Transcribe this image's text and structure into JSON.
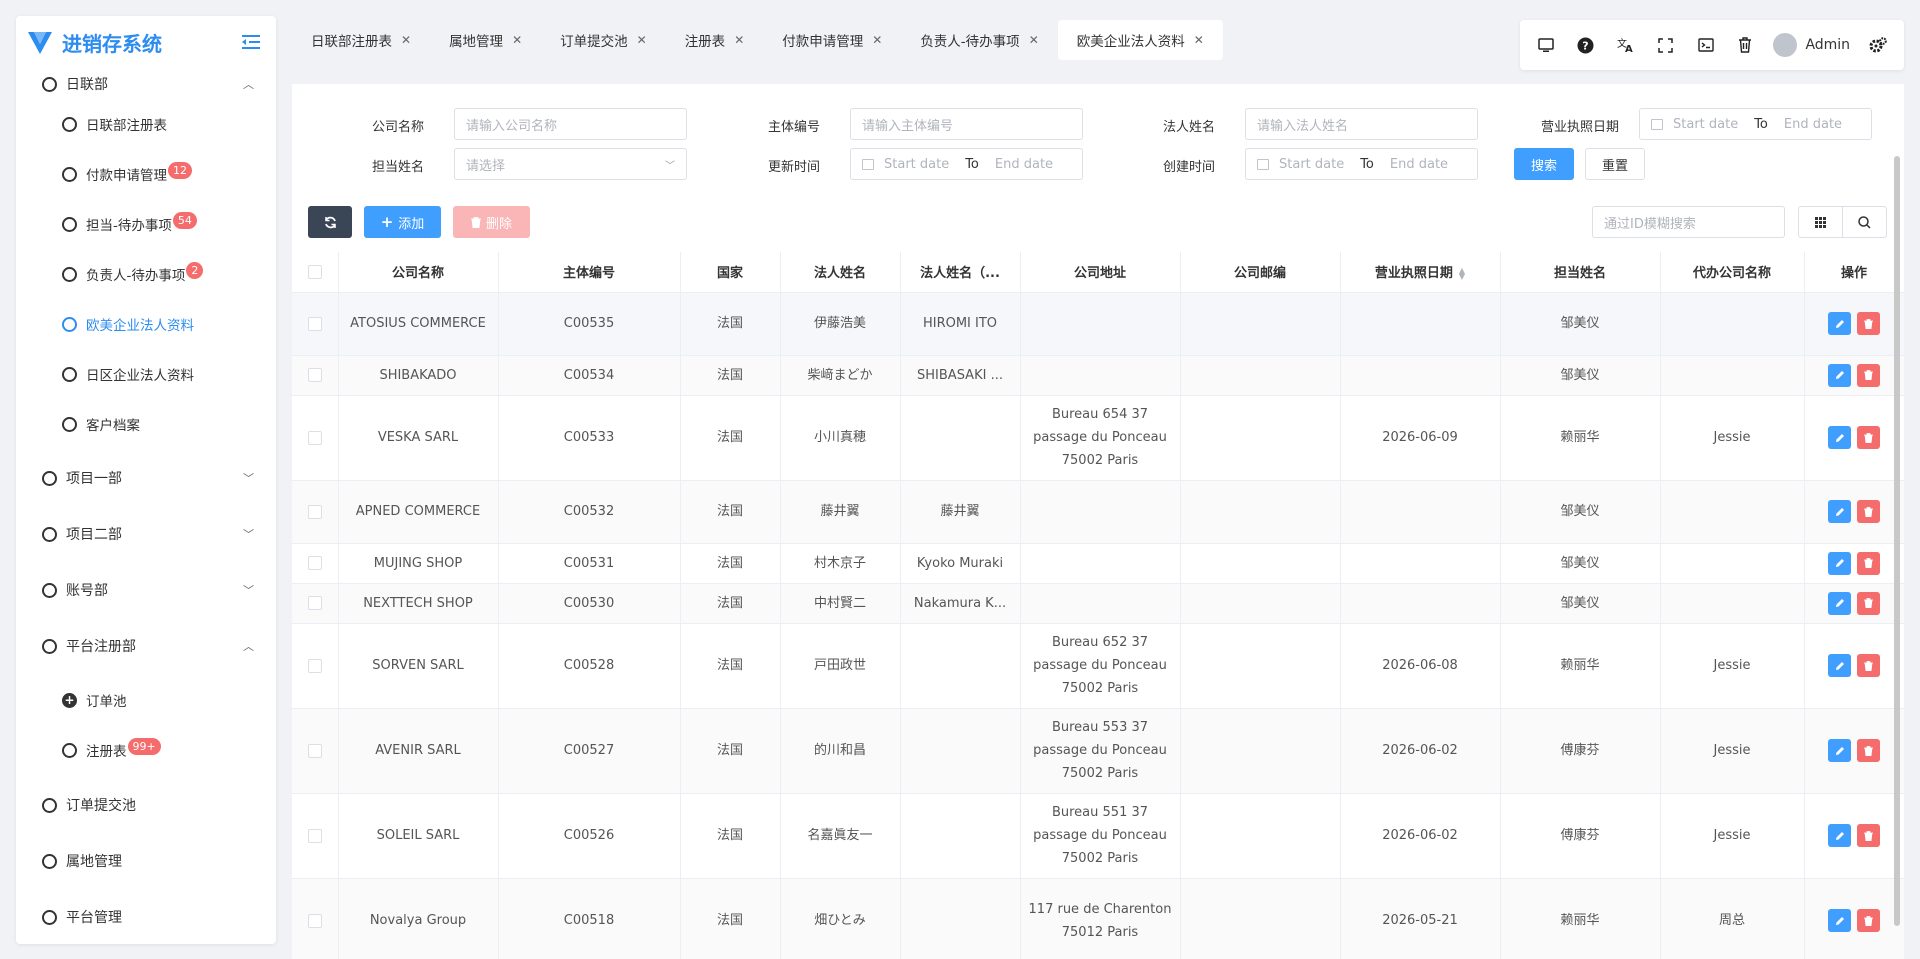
{
  "app": {
    "title": "进销存系统"
  },
  "sidebar": {
    "items": [
      {
        "label": "日联部",
        "level": 1,
        "expanded": true
      },
      {
        "label": "日联部注册表",
        "level": 2
      },
      {
        "label": "付款申请管理",
        "level": 2,
        "badge": "12"
      },
      {
        "label": "担当-待办事项",
        "level": 2,
        "badge": "54"
      },
      {
        "label": "负责人-待办事项",
        "level": 2,
        "badge": "2"
      },
      {
        "label": "欧美企业法人资料",
        "level": 2,
        "active": true
      },
      {
        "label": "日区企业法人资料",
        "level": 2
      },
      {
        "label": "客户档案",
        "level": 2
      },
      {
        "label": "项目一部",
        "level": 1,
        "expanded": false
      },
      {
        "label": "项目二部",
        "level": 1,
        "expanded": false
      },
      {
        "label": "账号部",
        "level": 1,
        "expanded": false
      },
      {
        "label": "平台注册部",
        "level": 1,
        "expanded": true
      },
      {
        "label": "订单池",
        "level": 2,
        "plus": true
      },
      {
        "label": "注册表",
        "level": 2,
        "badge": "99+"
      },
      {
        "label": "订单提交池",
        "level": 1
      },
      {
        "label": "属地管理",
        "level": 1
      },
      {
        "label": "平台管理",
        "level": 1
      }
    ]
  },
  "tabs": [
    {
      "label": "日联部注册表"
    },
    {
      "label": "属地管理"
    },
    {
      "label": "订单提交池"
    },
    {
      "label": "注册表"
    },
    {
      "label": "付款申请管理"
    },
    {
      "label": "负责人-待办事项"
    },
    {
      "label": "欧美企业法人资料",
      "active": true
    }
  ],
  "toolbar": {
    "user": "Admin"
  },
  "filters": {
    "company_name": {
      "label": "公司名称",
      "placeholder": "请输入公司名称"
    },
    "entity_no": {
      "label": "主体编号",
      "placeholder": "请输入主体编号"
    },
    "legal_name": {
      "label": "法人姓名",
      "placeholder": "请输入法人姓名"
    },
    "license_date": {
      "label": "营业执照日期",
      "start": "Start date",
      "to": "To",
      "end": "End date"
    },
    "owner": {
      "label": "担当姓名",
      "placeholder": "请选择"
    },
    "update_time": {
      "label": "更新时间",
      "start": "Start date",
      "to": "To",
      "end": "End date"
    },
    "create_time": {
      "label": "创建时间",
      "start": "Start date",
      "to": "To",
      "end": "End date"
    },
    "search_button": "搜索",
    "reset_button": "重置"
  },
  "actions": {
    "add": "添加",
    "delete": "删除",
    "id_search_placeholder": "通过ID模糊搜索"
  },
  "table": {
    "columns": [
      "公司名称",
      "主体编号",
      "国家",
      "法人姓名",
      "法人姓名（...",
      "公司地址",
      "公司邮编",
      "营业执照日期",
      "担当姓名",
      "代办公司名称",
      "操作"
    ],
    "rows": [
      [
        "ATOSIUS COMMERCE",
        "C00535",
        "法国",
        "伊藤浩美",
        "HIROMI ITO",
        "",
        "",
        "",
        "邹美仪",
        ""
      ],
      [
        "SHIBAKADO",
        "C00534",
        "法国",
        "柴﨑まどか",
        "SHIBASAKI ...",
        "",
        "",
        "",
        "邹美仪",
        ""
      ],
      [
        "VESKA SARL",
        "C00533",
        "法国",
        "小川真穂",
        "",
        "Bureau 654 37 passage du Ponceau 75002 Paris",
        "",
        "2026-06-09",
        "赖丽华",
        "Jessie"
      ],
      [
        "APNED COMMERCE",
        "C00532",
        "法国",
        "藤井翼",
        "藤井翼",
        "",
        "",
        "",
        "邹美仪",
        ""
      ],
      [
        "MUJING SHOP",
        "C00531",
        "法国",
        "村木京子",
        "Kyoko Muraki",
        "",
        "",
        "",
        "邹美仪",
        ""
      ],
      [
        "NEXTTECH SHOP",
        "C00530",
        "法国",
        "中村賢二",
        "Nakamura K...",
        "",
        "",
        "",
        "邹美仪",
        ""
      ],
      [
        "SORVEN SARL",
        "C00528",
        "法国",
        "戸田政世",
        "",
        "Bureau 652 37 passage du Ponceau 75002 Paris",
        "",
        "2026-06-08",
        "赖丽华",
        "Jessie"
      ],
      [
        "AVENIR SARL",
        "C00527",
        "法国",
        "的川和昌",
        "",
        "Bureau 553 37 passage du Ponceau 75002 Paris",
        "",
        "2026-06-02",
        "傅康芬",
        "Jessie"
      ],
      [
        "SOLEIL SARL",
        "C00526",
        "法国",
        "名嘉眞友一",
        "",
        "Bureau 551 37 passage du Ponceau 75002 Paris",
        "",
        "2026-06-02",
        "傅康芬",
        "Jessie"
      ],
      [
        "Novalya Group",
        "C00518",
        "法国",
        "畑ひとみ",
        "",
        "117 rue de Charenton 75012 Paris",
        "",
        "2026-05-21",
        "赖丽华",
        "周总"
      ]
    ]
  }
}
